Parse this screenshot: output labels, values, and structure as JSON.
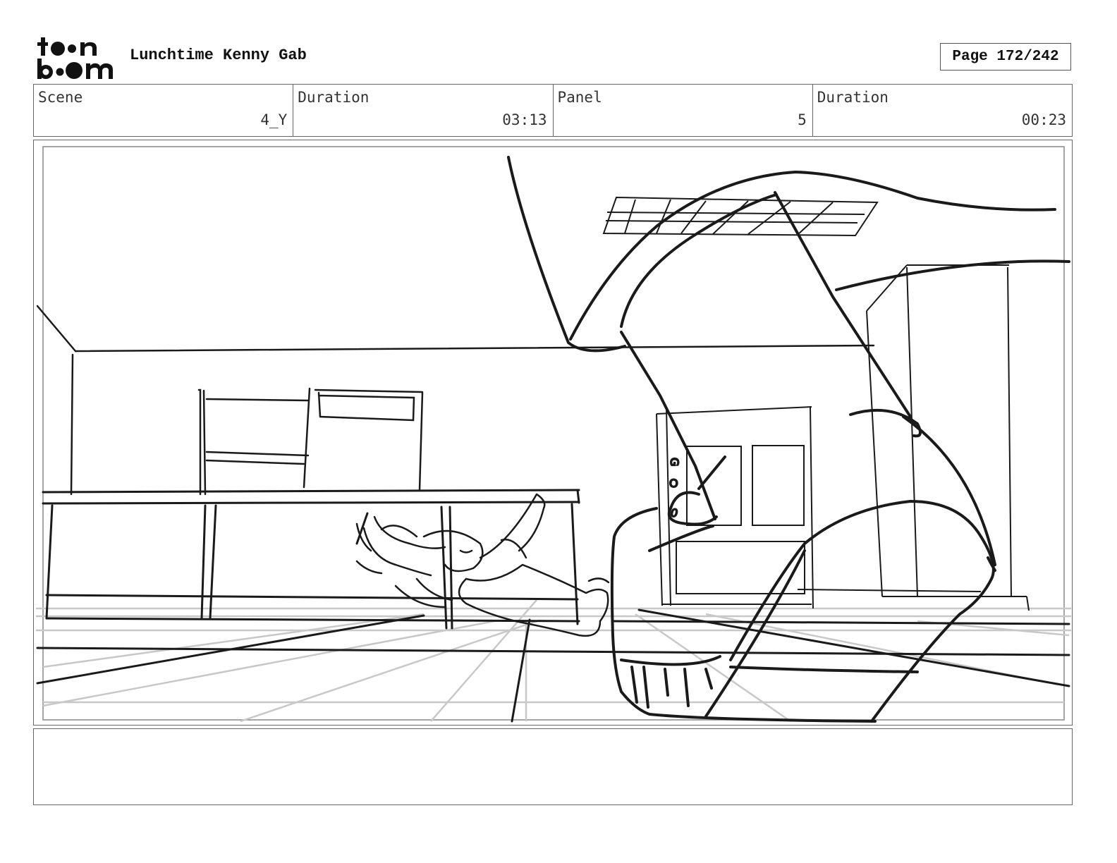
{
  "header": {
    "logo_text": "toon boom",
    "project_title": "Lunchtime Kenny Gab",
    "page_label": "Page 172/242"
  },
  "info": {
    "scene_label": "Scene",
    "scene_value": "4_Y",
    "scene_duration_label": "Duration",
    "scene_duration_value": "03:13",
    "panel_label": "Panel",
    "panel_value": "5",
    "panel_duration_label": "Duration",
    "panel_duration_value": "00:23"
  },
  "panel": {
    "image_name": "storyboard-sketch",
    "door_marks": [
      "G",
      "O",
      "0"
    ]
  },
  "notes": {
    "text": ""
  },
  "colors": {
    "ink": "#1a1a1a",
    "guide_gray": "#c8c8c8",
    "border": "#666666"
  }
}
